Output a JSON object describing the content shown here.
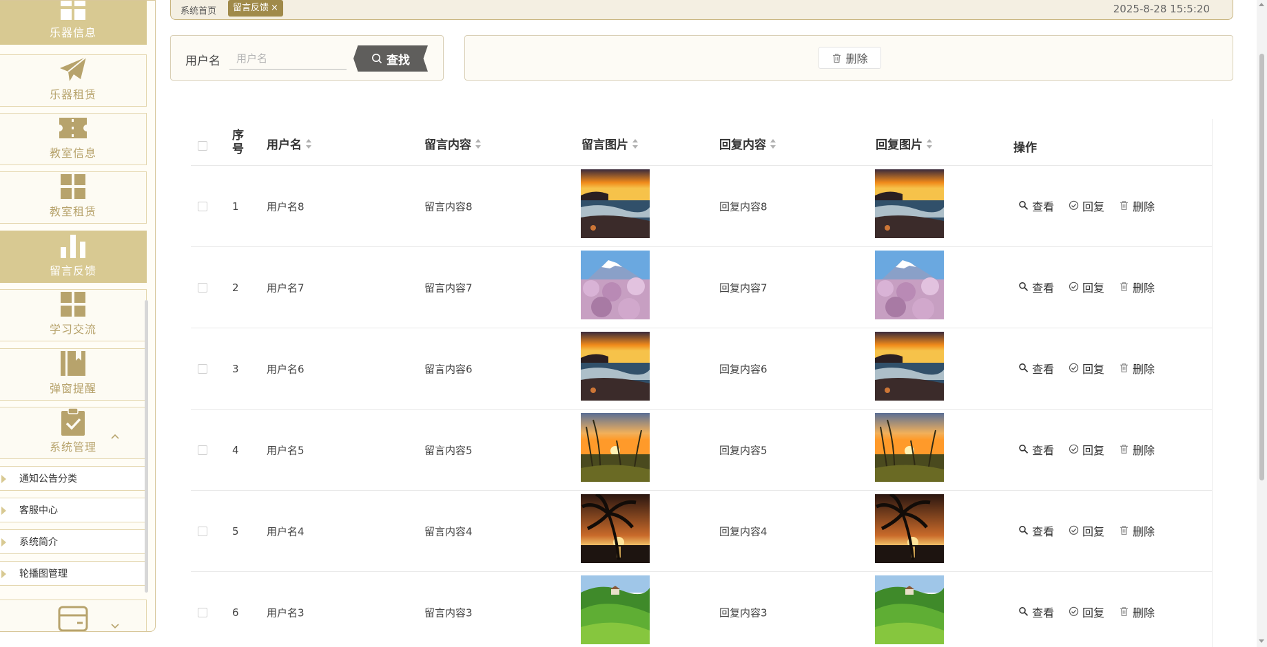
{
  "sidebar": {
    "items": [
      {
        "label": "乐器信息",
        "icon": "grid-icon",
        "active": true
      },
      {
        "label": "乐器租赁",
        "icon": "paper-plane-icon",
        "active": false
      },
      {
        "label": "教室信息",
        "icon": "ticket-icon",
        "active": false
      },
      {
        "label": "教室租赁",
        "icon": "grid-icon",
        "active": false
      },
      {
        "label": "留言反馈",
        "icon": "bar-chart-icon",
        "active": true
      },
      {
        "label": "学习交流",
        "icon": "grid-icon",
        "active": false
      },
      {
        "label": "弹窗提醒",
        "icon": "bookmark-book-icon",
        "active": false
      },
      {
        "label": "系统管理",
        "icon": "clipboard-check-icon",
        "active": false,
        "expanded": true
      },
      {
        "label": "",
        "icon": "card-icon",
        "active": false
      }
    ],
    "sub_items": [
      {
        "label": "通知公告分类"
      },
      {
        "label": "客服中心"
      },
      {
        "label": "系统简介"
      },
      {
        "label": "轮播图管理"
      }
    ]
  },
  "topbar": {
    "home": "系统首页",
    "active_tab": "留言反馈",
    "close_glyph": "×",
    "datetime": "2025-8-28 15:5:20"
  },
  "search": {
    "label": "用户名",
    "placeholder": "用户名",
    "value": "",
    "button": "查找"
  },
  "actions": {
    "delete": "删除"
  },
  "table": {
    "headers": {
      "index": "序号",
      "username": "用户名",
      "content": "留言内容",
      "image": "留言图片",
      "reply": "回复内容",
      "reply_image": "回复图片",
      "ops": "操作"
    },
    "ops": {
      "view": "查看",
      "reply": "回复",
      "delete": "删除"
    },
    "rows": [
      {
        "index": "1",
        "username": "用户名8",
        "content": "留言内容8",
        "reply": "回复内容8",
        "image": "sunset-sea-image"
      },
      {
        "index": "2",
        "username": "用户名7",
        "content": "留言内容7",
        "reply": "回复内容7",
        "image": "mount-fuji-blossom-image"
      },
      {
        "index": "3",
        "username": "用户名6",
        "content": "留言内容6",
        "reply": "回复内容6",
        "image": "sunset-sea-image"
      },
      {
        "index": "4",
        "username": "用户名5",
        "content": "留言内容5",
        "reply": "回复内容5",
        "image": "grass-sunset-image"
      },
      {
        "index": "5",
        "username": "用户名4",
        "content": "留言内容4",
        "reply": "回复内容4",
        "image": "palm-sunset-image"
      },
      {
        "index": "6",
        "username": "用户名3",
        "content": "留言内容3",
        "reply": "回复内容3",
        "image": "green-hills-image"
      }
    ]
  },
  "colors": {
    "accent": "#d8c992",
    "accent_dark": "#a08a4a",
    "icon": "#b7a36c",
    "search_button": "#5f5e5c"
  }
}
